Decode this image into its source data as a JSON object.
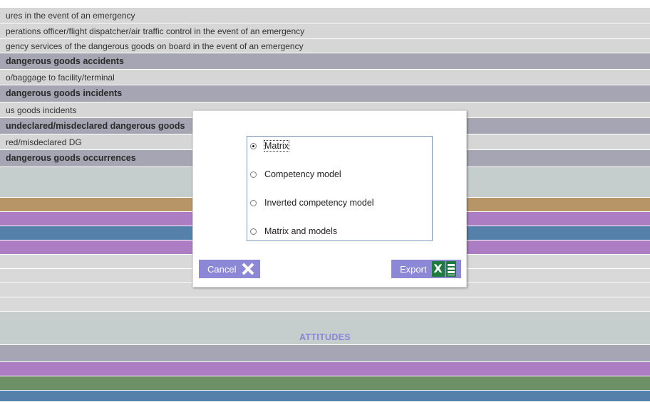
{
  "rows": [
    {
      "text": "ures in the event of an emergency",
      "bold": false,
      "color": "#d6d6d6"
    },
    {
      "text": "perations officer/flight dispatcher/air traffic control in the event of an emergency",
      "bold": false,
      "color": "#d6d6d6"
    },
    {
      "text": "gency services of the dangerous goods on board in the event of an emergency",
      "bold": false,
      "color": "#d6d6d6"
    },
    {
      "text": "dangerous goods accidents",
      "bold": true,
      "color": "#a5a5b3"
    },
    {
      "text": "o/baggage to facility/terminal",
      "bold": false,
      "color": "#d6d6d6"
    },
    {
      "text": "dangerous goods incidents",
      "bold": true,
      "color": "#a5a5b3"
    },
    {
      "text": "us goods incidents",
      "bold": false,
      "color": "#d6d6d6"
    },
    {
      "text": "undeclared/misdeclared dangerous goods",
      "bold": true,
      "color": "#a5a5b3"
    },
    {
      "text": "red/misdeclared DG",
      "bold": false,
      "color": "#d6d6d6"
    },
    {
      "text": "dangerous goods occurrences",
      "bold": true,
      "color": "#a5a5b3"
    }
  ],
  "band_colors": {
    "light_grey_block": "#c5cdcd",
    "tan": "#b79566",
    "purple": "#ad7dc4",
    "blue": "#5580a9",
    "light_grey": "#d9d9d9",
    "slate": "#a5a5b3",
    "green": "#6e9066"
  },
  "attitudes_label": "ATTITUDES",
  "dialog": {
    "options": [
      {
        "label": "Matrix",
        "checked": true
      },
      {
        "label": "Competency model",
        "checked": false
      },
      {
        "label": "Inverted competency model",
        "checked": false
      },
      {
        "label": "Matrix and models",
        "checked": false
      }
    ],
    "cancel_label": "Cancel",
    "export_label": "Export",
    "excel_icon_letter": "X",
    "button_color": "#8d88d6"
  }
}
